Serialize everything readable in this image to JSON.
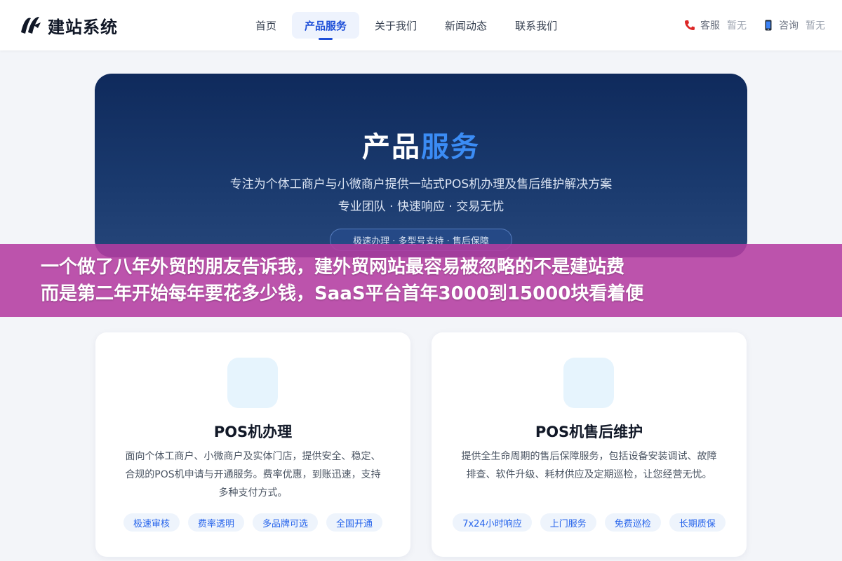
{
  "header": {
    "logo_text": "建站系统",
    "nav": [
      {
        "label": "首页",
        "active": false
      },
      {
        "label": "产品服务",
        "active": true
      },
      {
        "label": "关于我们",
        "active": false
      },
      {
        "label": "新闻动态",
        "active": false
      },
      {
        "label": "联系我们",
        "active": false
      }
    ],
    "contacts": [
      {
        "icon": "phone-icon",
        "label": "客服",
        "value": "暂无"
      },
      {
        "icon": "mobile-icon",
        "label": "咨询",
        "value": "暂无"
      }
    ]
  },
  "hero": {
    "title_main": "产品",
    "title_accent": "服务",
    "subtitle_1": "专注为个体工商户与小微商户提供一站式POS机办理及售后维护解决方案",
    "subtitle_2": "专业团队 · 快速响应 · 交易无忧",
    "badge": "极速办理 · 多型号支持 · 售后保障"
  },
  "overlay": {
    "line_1": "一个做了八年外贸的朋友告诉我，建外贸网站最容易被忽略的不是建站费",
    "line_2": "而是第二年开始每年要花多少钱，SaaS平台首年3000到15000块看着便"
  },
  "cards": [
    {
      "title": "POS机办理",
      "description": "面向个体工商户、小微商户及实体门店，提供安全、稳定、合规的POS机申请与开通服务。费率优惠，到账迅速，支持多种支付方式。",
      "tags": [
        "极速审核",
        "费率透明",
        "多品牌可选",
        "全国开通"
      ]
    },
    {
      "title": "POS机售后维护",
      "description": "提供全生命周期的售后保障服务，包括设备安装调试、故障排查、软件升级、耗材供应及定期巡检，让您经营无忧。",
      "tags": [
        "7x24小时响应",
        "上门服务",
        "免费巡检",
        "长期质保"
      ]
    }
  ],
  "colors": {
    "accent": "#1d4ed8",
    "hero_bg": "#0f2a5c",
    "hero_accent": "#3b8cf5",
    "overlay_bg": "#b43ca0",
    "tag_text": "#2563eb"
  }
}
